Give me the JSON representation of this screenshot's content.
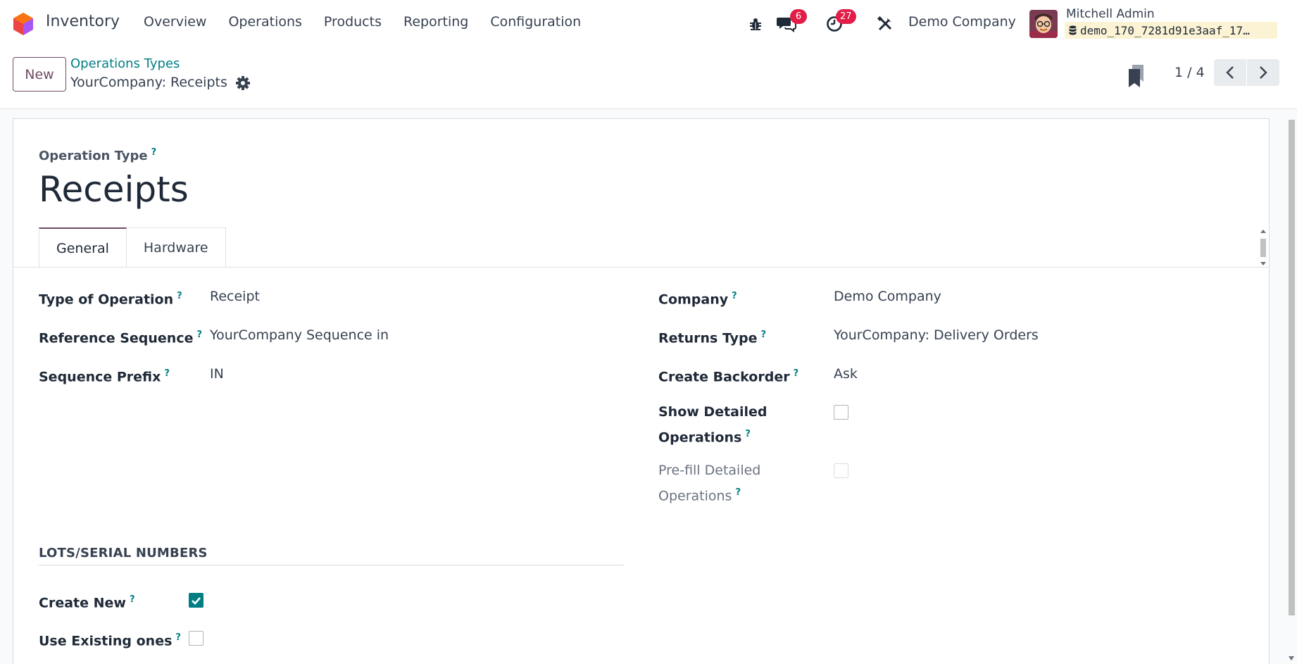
{
  "navbar": {
    "app_name": "Inventory",
    "menu": [
      "Overview",
      "Operations",
      "Products",
      "Reporting",
      "Configuration"
    ],
    "messages_count": "6",
    "activities_count": "27",
    "company": "Demo Company",
    "user_name": "Mitchell Admin",
    "database": "demo_170_7281d91e3aaf_17…"
  },
  "control": {
    "new_label": "New",
    "breadcrumb_parent": "Operations Types",
    "breadcrumb_current": "YourCompany: Receipts",
    "pager": "1 / 4"
  },
  "form": {
    "record_label": "Operation Type",
    "record_title": "Receipts",
    "tabs": [
      "General",
      "Hardware"
    ],
    "help_mark": "?",
    "left": {
      "type_of_operation": {
        "label": "Type of Operation",
        "value": "Receipt"
      },
      "reference_sequence": {
        "label": "Reference Sequence",
        "value": "YourCompany Sequence in"
      },
      "sequence_prefix": {
        "label": "Sequence Prefix",
        "value": "IN"
      }
    },
    "right": {
      "company": {
        "label": "Company",
        "value": "Demo Company"
      },
      "returns_type": {
        "label": "Returns Type",
        "value": "YourCompany: Delivery Orders"
      },
      "create_backorder": {
        "label": "Create Backorder",
        "value": "Ask"
      },
      "show_detailed_operations": {
        "label_line1": "Show Detailed",
        "label_line2": "Operations",
        "checked": false
      },
      "prefill_detailed_operations": {
        "label_line1": "Pre-fill Detailed",
        "label_line2": "Operations",
        "checked": false
      }
    },
    "lots_section": {
      "title": "LOTS/SERIAL NUMBERS",
      "create_new": {
        "label": "Create New",
        "checked": true
      },
      "use_existing": {
        "label": "Use Existing ones",
        "checked": false
      }
    }
  },
  "colors": {
    "brand": "#714b67",
    "accent": "#017e84",
    "badge": "#e11d48"
  }
}
